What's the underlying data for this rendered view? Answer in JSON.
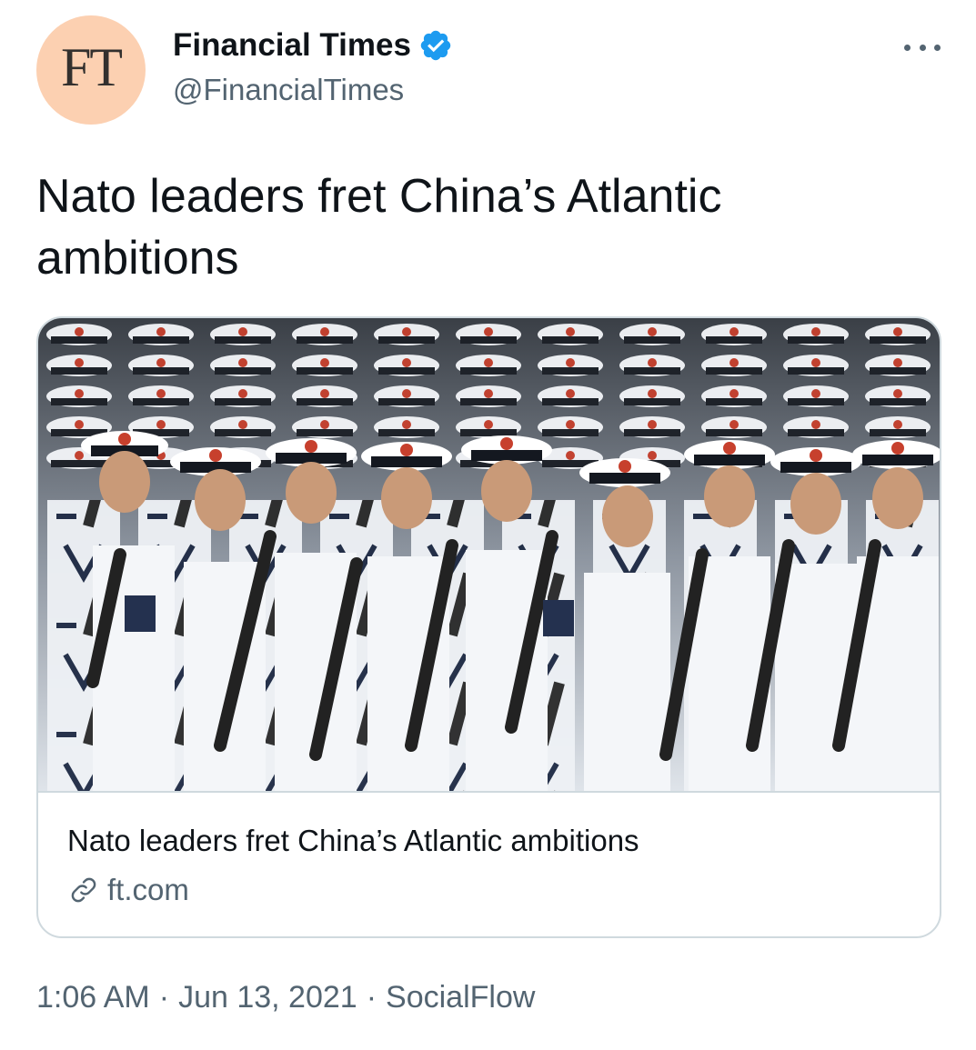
{
  "author": {
    "avatar_text": "FT",
    "display_name": "Financial Times",
    "handle": "@FinancialTimes",
    "verified": true,
    "verified_icon": "verified-badge-icon"
  },
  "menu": {
    "icon": "more-options-icon"
  },
  "tweet": {
    "text": "Nato leaders fret China’s Atlantic ambitions"
  },
  "card": {
    "image_description_icon": "marching-sailors-photo",
    "title": "Nato leaders fret China’s Atlantic ambitions",
    "domain": "ft.com",
    "domain_icon": "link-icon"
  },
  "meta": {
    "time": "1:06 AM",
    "date": "Jun 13, 2021",
    "source": "SocialFlow",
    "separator": "·"
  },
  "colors": {
    "avatar_bg": "#fcd0b1",
    "verified_blue": "#1d9bf0",
    "secondary_text": "#536471",
    "border": "#cfd9de"
  }
}
